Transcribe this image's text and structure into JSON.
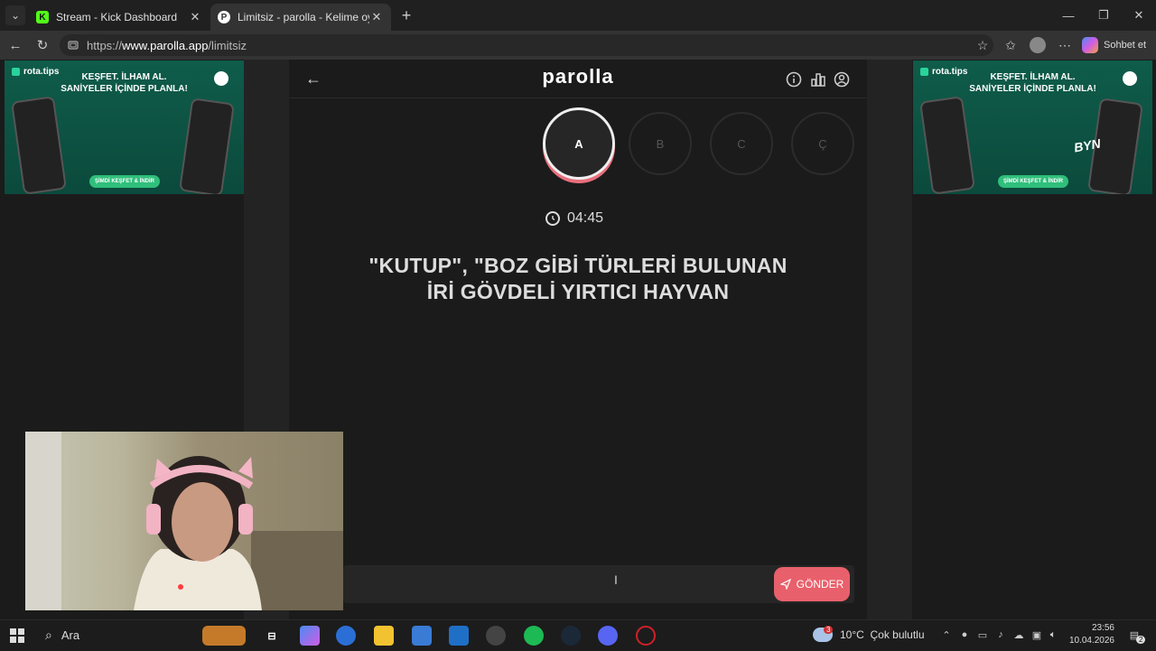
{
  "browser": {
    "tabs": [
      {
        "title": "Stream - Kick Dashboard",
        "icon": "kick-icon"
      },
      {
        "title": "Limitsiz - parolla - Kelime oyunu",
        "icon": "parolla-icon"
      }
    ],
    "url_scheme": "https://",
    "url_host": "www.parolla.app",
    "url_path": "/limitsiz",
    "sohbet": "Sohbet et"
  },
  "ads": {
    "logo": "rota.tips",
    "headline_1": "KEŞFET. İLHAM AL.",
    "headline_2": "SANİYELER İÇİNDE PLANLA!",
    "cta": "ŞİMDİ KEŞFET & İNDİR",
    "right_badge": "BYN"
  },
  "app": {
    "logo": "parolla",
    "letters": [
      "A",
      "B",
      "C",
      "Ç"
    ],
    "active_letter": "A",
    "timer": "04:45",
    "question_line_1": "\"KUTUP\", \"BOZ GİBİ TÜRLERİ BULUNAN",
    "question_line_2": "İRİ GÖVDELİ YIRTICI HAYVAN",
    "send_label": "GÖNDER",
    "accent": "#e8606b"
  },
  "taskbar": {
    "search_label": "Ara",
    "weather": "10°C  Çok bulutlu",
    "weather_badge": "3",
    "time": "23:56",
    "date": "10.04.2026",
    "notification_count": "2"
  }
}
